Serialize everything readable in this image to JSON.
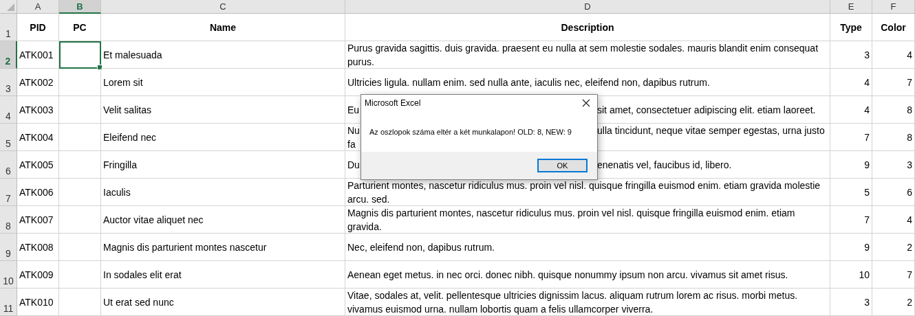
{
  "columns": [
    {
      "label": "A",
      "selected": false
    },
    {
      "label": "B",
      "selected": true
    },
    {
      "label": "C",
      "selected": false
    },
    {
      "label": "D",
      "selected": false
    },
    {
      "label": "E",
      "selected": false
    },
    {
      "label": "F",
      "selected": false
    }
  ],
  "rows": [
    {
      "number": "1",
      "selected": false,
      "kind": "header",
      "cells": [
        "PID",
        "PC",
        "Name",
        "Description",
        "Type",
        "Color"
      ]
    },
    {
      "number": "2",
      "selected": true,
      "kind": "data",
      "cells": [
        "ATK001",
        null,
        "Et malesuada",
        "Purus gravida sagittis. duis gravida. praesent eu nulla at sem molestie sodales. mauris blandit enim consequat purus.",
        "3",
        "4"
      ]
    },
    {
      "number": "3",
      "selected": false,
      "kind": "data",
      "cells": [
        "ATK002",
        null,
        "Lorem sit",
        "Ultricies ligula. nullam enim. sed nulla ante, iaculis nec, eleifend non, dapibus rutrum.",
        "4",
        "7"
      ]
    },
    {
      "number": "4",
      "selected": false,
      "kind": "data",
      "cells": [
        "ATK003",
        null,
        "Velit salitas",
        {
          "kind": "covered",
          "left": [
            "Eu"
          ],
          "right": "sit amet, consectetuer adipiscing elit. etiam laoreet."
        },
        "4",
        "8"
      ]
    },
    {
      "number": "5",
      "selected": false,
      "kind": "data",
      "cells": [
        "ATK004",
        null,
        "Eleifend nec",
        {
          "kind": "covered",
          "left": [
            "Nu",
            "fa"
          ],
          "right": "ulla tincidunt, neque vitae semper egestas, urna justo"
        },
        "7",
        "8"
      ]
    },
    {
      "number": "6",
      "selected": false,
      "kind": "data",
      "cells": [
        "ATK005",
        null,
        "Fringilla",
        {
          "kind": "covered",
          "left": [
            "Du"
          ],
          "right": "enenatis vel, faucibus id, libero."
        },
        "9",
        "3"
      ]
    },
    {
      "number": "7",
      "selected": false,
      "kind": "data",
      "cells": [
        "ATK006",
        null,
        "Iaculis",
        "Parturient montes, nascetur ridiculus mus. proin vel nisl. quisque fringilla euismod enim. etiam gravida molestie arcu. sed.",
        "5",
        "6"
      ]
    },
    {
      "number": "8",
      "selected": false,
      "kind": "data",
      "cells": [
        "ATK007",
        null,
        "Auctor vitae aliquet nec",
        "Magnis dis parturient montes, nascetur ridiculus mus. proin vel nisl. quisque fringilla euismod enim. etiam gravida.",
        "7",
        "4"
      ]
    },
    {
      "number": "9",
      "selected": false,
      "kind": "data",
      "cells": [
        "ATK008",
        null,
        "Magnis dis parturient montes nascetur",
        "Nec, eleifend non, dapibus rutrum.",
        "9",
        "2"
      ]
    },
    {
      "number": "10",
      "selected": false,
      "kind": "data",
      "cells": [
        "ATK009",
        null,
        "In sodales elit erat",
        "Aenean eget metus. in nec orci. donec nibh. quisque nonummy ipsum non arcu. vivamus sit amet risus.",
        "10",
        "7"
      ]
    },
    {
      "number": "11",
      "selected": false,
      "kind": "data",
      "cells": [
        "ATK010",
        null,
        "Ut erat sed nunc",
        "Vitae, sodales at, velit. pellentesque ultricies dignissim lacus. aliquam rutrum lorem ac risus. morbi metus. vivamus euismod urna. nullam lobortis quam a felis ullamcorper viverra.",
        "3",
        "2"
      ]
    }
  ],
  "dialog": {
    "title": "Microsoft Excel",
    "message": "Az oszlopok száma eltér a két munkalapon! OLD: 8, NEW: 9",
    "buttons": [
      {
        "label": "OK",
        "focused": true
      }
    ]
  }
}
